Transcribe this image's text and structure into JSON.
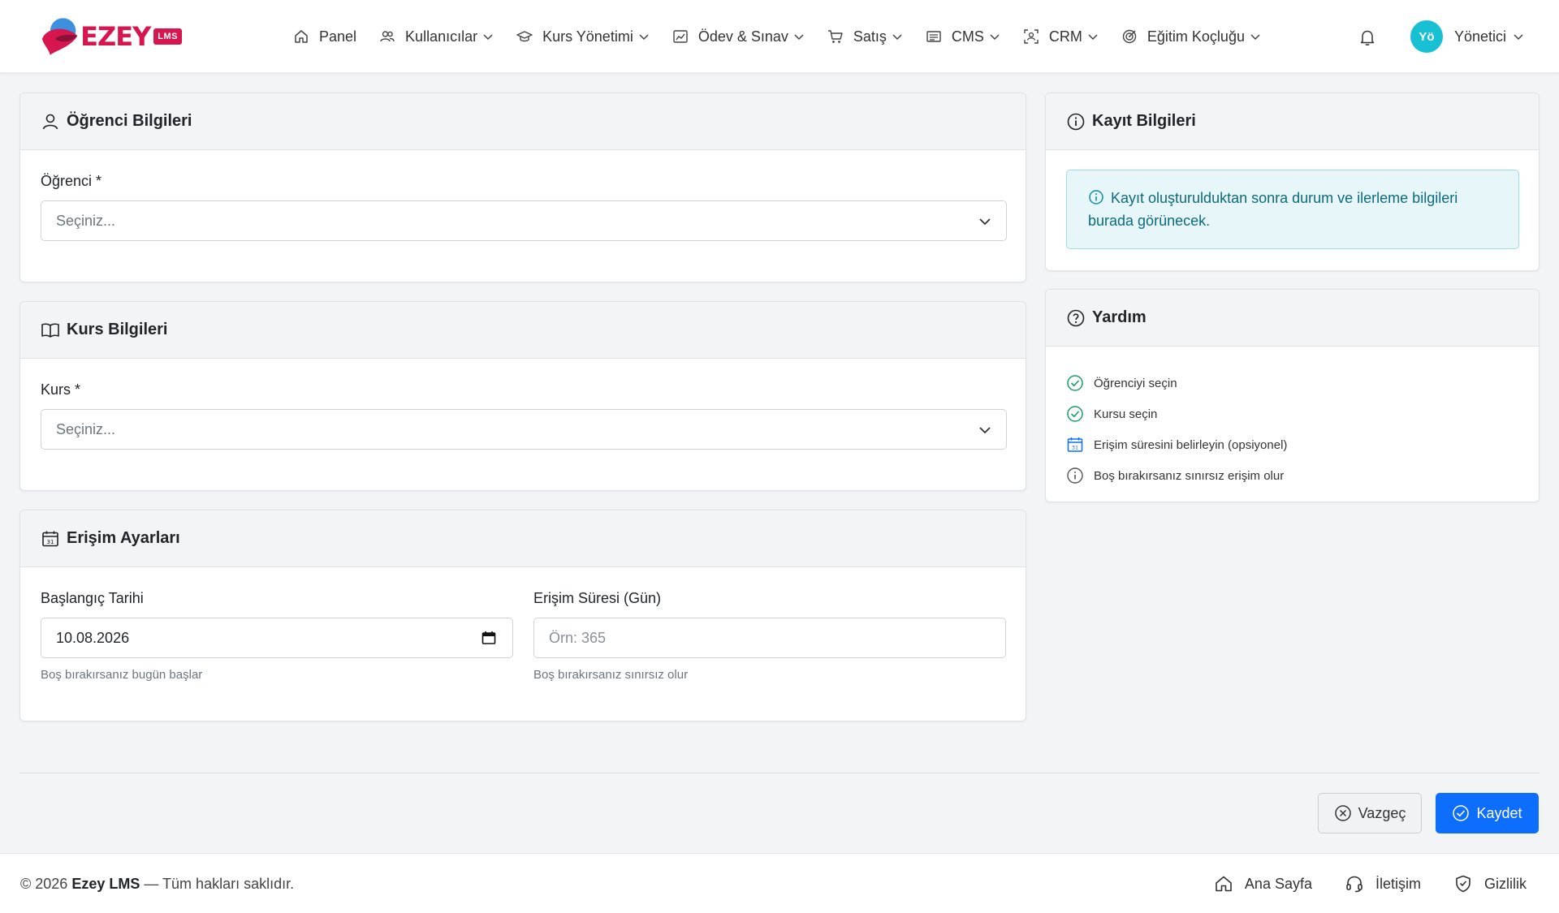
{
  "brand": {
    "name": "EZEY",
    "badge": "LMS"
  },
  "nav": {
    "items": [
      {
        "label": "Panel",
        "icon": "home-icon",
        "dropdown": false
      },
      {
        "label": "Kullanıcılar",
        "icon": "users-icon",
        "dropdown": true
      },
      {
        "label": "Kurs Yönetimi",
        "icon": "graduation-cap-icon",
        "dropdown": true
      },
      {
        "label": "Ödev & Sınav",
        "icon": "image-chart-icon",
        "dropdown": true
      },
      {
        "label": "Satış",
        "icon": "cart-icon",
        "dropdown": true
      },
      {
        "label": "CMS",
        "icon": "newspaper-icon",
        "dropdown": true
      },
      {
        "label": "CRM",
        "icon": "person-bounding-icon",
        "dropdown": true
      },
      {
        "label": "Eğitim Koçluğu",
        "icon": "target-icon",
        "dropdown": true
      }
    ],
    "notifications_icon": "bell-icon",
    "user": {
      "initials": "Yö",
      "name": "Yönetici"
    }
  },
  "student_card": {
    "title": "Öğrenci Bilgileri",
    "field_label": "Öğrenci *",
    "select_placeholder": "Seçiniz..."
  },
  "course_card": {
    "title": "Kurs Bilgileri",
    "field_label": "Kurs *",
    "select_placeholder": "Seçiniz..."
  },
  "access_card": {
    "title": "Erişim Ayarları",
    "start_date": {
      "label": "Başlangıç Tarihi",
      "value": "10.08.2026",
      "hint": "Boş bırakırsanız bugün başlar"
    },
    "duration": {
      "label": "Erişim Süresi (Gün)",
      "placeholder": "Örn: 365",
      "hint": "Boş bırakırsanız sınırsız olur"
    }
  },
  "record_card": {
    "title": "Kayıt Bilgileri",
    "alert_text": "Kayıt oluşturulduktan sonra durum ve ilerleme bilgileri burada görünecek."
  },
  "help_card": {
    "title": "Yardım",
    "items": [
      {
        "text": "Öğrenciyi seçin",
        "icon": "check-circle-icon"
      },
      {
        "text": "Kursu seçin",
        "icon": "check-circle-icon"
      },
      {
        "text": "Erişim süresini belirleyin (opsiyonel)",
        "icon": "calendar-icon"
      },
      {
        "text": "Boş bırakırsanız sınırsız erişim olur",
        "icon": "info-circle-icon"
      }
    ]
  },
  "actions": {
    "cancel": "Vazgeç",
    "save": "Kaydet"
  },
  "footer": {
    "copyright_prefix": "© 2026",
    "copyright_brand": "Ezey LMS",
    "copyright_suffix": "— Tüm hakları saklıdır.",
    "links": [
      "Ana Sayfa",
      "İletişim",
      "Gizlilik"
    ]
  },
  "colors": {
    "brand": "#d7154e",
    "primary": "#0d6efd",
    "avatar": "#17c1d3",
    "help_check": "#1a9c6b",
    "help_calendar": "#0d6efd",
    "info_alert_bg": "#e7f6f9"
  }
}
